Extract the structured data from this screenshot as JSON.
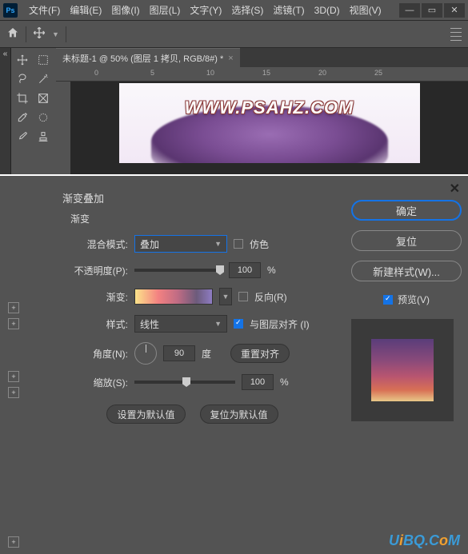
{
  "app": {
    "logo": "Ps"
  },
  "menu": {
    "file": "文件(F)",
    "edit": "编辑(E)",
    "image": "图像(I)",
    "layer": "图层(L)",
    "text": "文字(Y)",
    "select": "选择(S)",
    "filter": "滤镜(T)",
    "threed": "3D(D)",
    "view": "视图(V)"
  },
  "tab": {
    "title": "未标题-1 @ 50% (图层 1 拷贝, RGB/8#) *",
    "close": "×"
  },
  "ruler": {
    "m0": "0",
    "m5": "5",
    "m10": "10",
    "m15": "15",
    "m20": "20",
    "m25": "25"
  },
  "canvas": {
    "watermark": "WWW.PSAHZ.COM"
  },
  "dialog": {
    "close": "✕",
    "title": "渐变叠加",
    "subtitle": "渐变",
    "labels": {
      "blend": "混合模式:",
      "opacity": "不透明度(P):",
      "gradient": "渐变:",
      "style": "样式:",
      "angle": "角度(N):",
      "scale": "缩放(S):",
      "deg": "度"
    },
    "values": {
      "blend": "叠加",
      "opacity": "100",
      "style": "线性",
      "angle": "90",
      "scale": "100"
    },
    "checkboxes": {
      "dither": "仿色",
      "reverse": "反向(R)",
      "align": "与图层对齐 (I)"
    },
    "buttons": {
      "reset_align": "重置对齐",
      "set_default": "设置为默认值",
      "reset_default": "复位为默认值",
      "ok": "确定",
      "cancel": "复位",
      "new_style": "新建样式(W)...",
      "preview": "预览(V)"
    },
    "pct": "%"
  },
  "footer": {
    "brand1": "U",
    "brand2": "i",
    "brand3": "BQ.C",
    "brand4": "o",
    "brand5": "M"
  }
}
